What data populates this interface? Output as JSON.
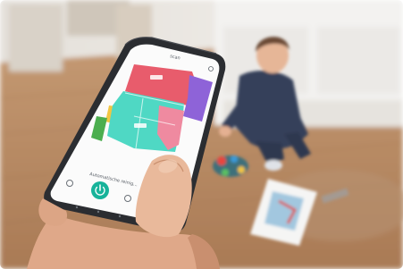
{
  "scene": {
    "type": "photo",
    "subject": "hand-holding-smartphone-robot-vacuum-map-app",
    "background": "child-playing-on-wooden-floor",
    "colors": {
      "wall": "#ece8e3",
      "floor": "#b88a63",
      "cabinet": "#f4f3f1",
      "phone_body": "#2b2d31",
      "screen": "#fbfbfb",
      "map_red": "#e85c6c",
      "map_teal": "#4fd8c4",
      "map_purple": "#8e63d8",
      "map_green": "#4cae4f",
      "map_yellow": "#f2c542",
      "start_button": "#17b39a",
      "skin": "#e9b99b"
    }
  },
  "phone_screen": {
    "header_title": "scan",
    "status_text": "Automatische reinig...",
    "start_icon": "power-icon",
    "left_icon": "settings-icon",
    "right_icon": "schedule-icon"
  }
}
